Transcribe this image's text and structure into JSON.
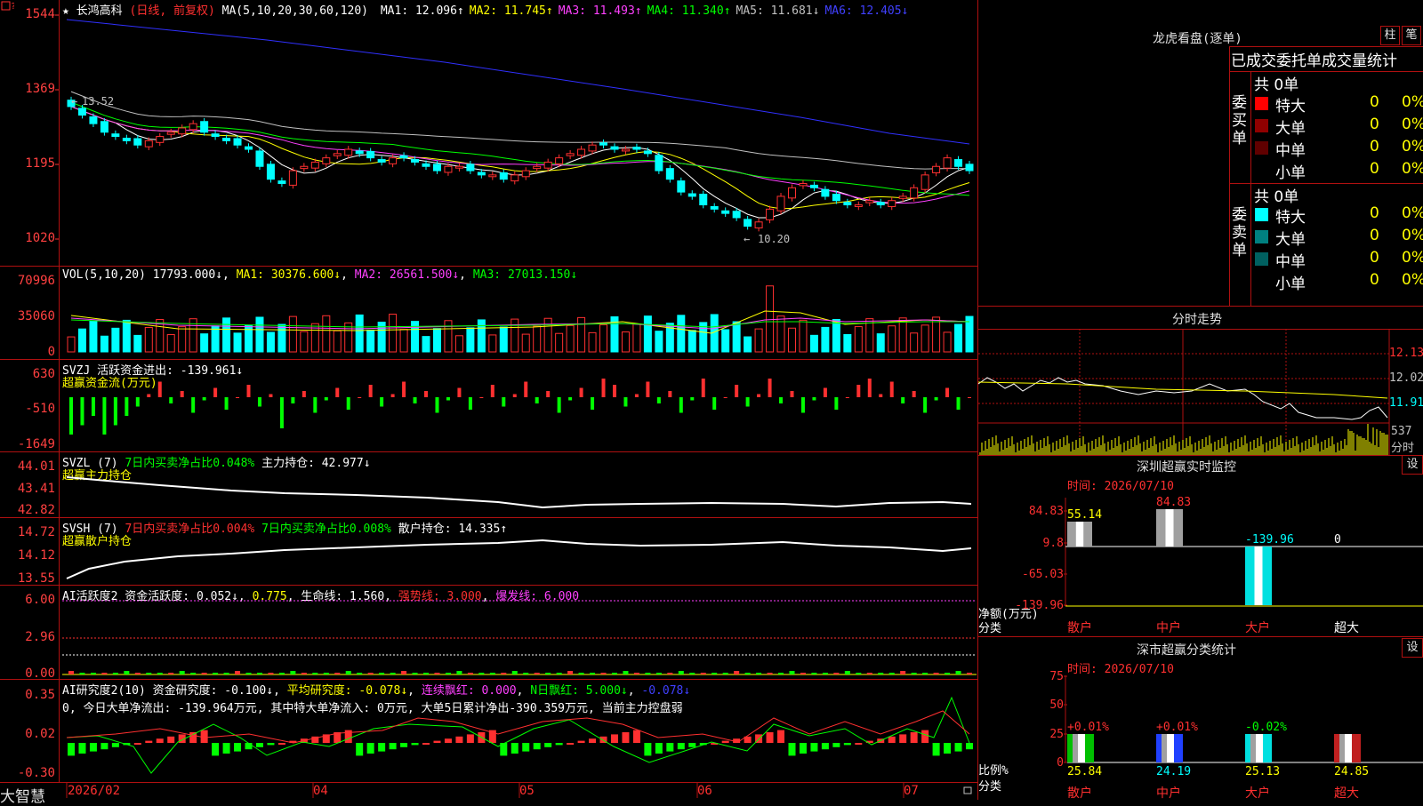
{
  "main": {
    "stock_name": "长鸿高科",
    "period_note": "(日线, 前复权)",
    "ma_header": "MA(5,10,20,30,60,120)",
    "ma_items": [
      {
        "label": "MA1:",
        "value": "12.096↑",
        "color": "#ffffff"
      },
      {
        "label": "MA2:",
        "value": "11.745↑",
        "color": "#ffff00"
      },
      {
        "label": "MA3:",
        "value": "11.493↑",
        "color": "#ff40ff"
      },
      {
        "label": "MA4:",
        "value": "11.340↑",
        "color": "#00ff00"
      },
      {
        "label": "MA5:",
        "value": "11.681↓",
        "color": "#c0c0c0"
      },
      {
        "label": "MA6:",
        "value": "12.405↓",
        "color": "#4040ff"
      }
    ],
    "y_ticks": [
      "1544",
      "1369",
      "1195",
      "1020"
    ],
    "high_note": "13.52",
    "low_note": "10.20"
  },
  "vol": {
    "header": "VOL(5,10,20)",
    "value": "17793.000↓",
    "ma1": "MA1: 30376.600↓",
    "ma2": "MA2: 26561.500↓",
    "ma3": "MA3: 27013.150↓",
    "y_ticks": [
      "70996",
      "35060",
      "0"
    ]
  },
  "svzj": {
    "header": "SVZJ  活跃资金进出: -139.961↓",
    "subtitle": "超赢资金流(万元)",
    "y_ticks": [
      "630",
      "-510",
      "-1649"
    ]
  },
  "svzl": {
    "header_a": "SVZL (7)",
    "header_b": "7日内买卖净占比0.048%",
    "header_c": "主力持仓: 42.977↓",
    "subtitle": "超赢主力持仓",
    "y_ticks": [
      "44.01",
      "43.41",
      "42.82"
    ]
  },
  "svsh": {
    "header_a": "SVSH (7)",
    "header_b": "7日内买卖净占比0.004%",
    "header_c": "7日内买卖净占比0.008%",
    "header_d": "散户持仓: 14.335↑",
    "subtitle": "超赢散户持仓",
    "y_ticks": [
      "14.72",
      "14.12",
      "13.55"
    ]
  },
  "ai1": {
    "header_a": "AI活跃度2 资金活跃度: 0.052↓",
    "header_b": "0.775",
    "header_c": "生命线: 1.560",
    "header_d": "强势线: 3.000",
    "header_e": "爆发线: 6.000",
    "y_ticks": [
      "6.00",
      "2.96",
      "0.00"
    ]
  },
  "ai2": {
    "header_a": "AI研究度2(10) 资金研究度: -0.100↓",
    "header_b": "平均研究度: -0.078↓",
    "header_c": "连续飘红: 0.000",
    "header_d": "N日飘红: 5.000↓",
    "header_e": "-0.078↓",
    "summary": "0, 今日大单净流出: -139.964万元, 其中特大单净流入: 0万元, 大单5日累计净出-390.359万元, 当前主力控盘弱",
    "y_ticks": [
      "0.35",
      "0.02",
      "-0.30"
    ]
  },
  "x_axis": {
    "labels": [
      "2026/02",
      "04",
      "05",
      "06",
      "07"
    ]
  },
  "brand": "大智慧",
  "right": {
    "lhb_title": "龙虎看盘(逐单)",
    "btn_bar": "柱",
    "btn_pen": "笔",
    "stats_title": "已成交委托单成交量统计",
    "buy_label": "委买单",
    "sell_label": "委卖单",
    "buy_total": "共 0单",
    "sell_total": "共 0单",
    "buy_rows": [
      {
        "name": "特大",
        "count": "0",
        "pct": "0%",
        "color": "#ff0000"
      },
      {
        "name": "大单",
        "count": "0",
        "pct": "0%",
        "color": "#900000"
      },
      {
        "name": "中单",
        "count": "0",
        "pct": "0%",
        "color": "#600000"
      },
      {
        "name": "小单",
        "count": "0",
        "pct": "0%",
        "color": "#000000"
      }
    ],
    "sell_rows": [
      {
        "name": "特大",
        "count": "0",
        "pct": "0%",
        "color": "#00ffff"
      },
      {
        "name": "大单",
        "count": "0",
        "pct": "0%",
        "color": "#008080"
      },
      {
        "name": "中单",
        "count": "0",
        "pct": "0%",
        "color": "#006060"
      },
      {
        "name": "小单",
        "count": "0",
        "pct": "0%",
        "color": "#000000"
      }
    ],
    "intraday_title": "分时走势",
    "intraday_ticks": [
      "12.13",
      "12.02",
      "11.91"
    ],
    "intraday_vol": "537",
    "intraday_vol_label": "分时",
    "sz_monitor_title": "深圳超赢实时监控",
    "sz_btn": "设",
    "monitor_time": "时间: 2026/07/10",
    "monitor_ticks": [
      "84.83",
      "9.8",
      "-65.03",
      "-139.96"
    ],
    "monitor_values": [
      "55.14",
      "84.83",
      "-139.96",
      "0"
    ],
    "monitor_unit": "净额(万元)",
    "monitor_cat": "分类",
    "monitor_cats": [
      "散户",
      "中户",
      "大户",
      "超大"
    ],
    "sz_class_title": "深市超赢分类统计",
    "class_btn": "设",
    "class_time": "时间: 2026/07/10",
    "class_ticks": [
      "75",
      "50",
      "25",
      "0"
    ],
    "class_pct_top": [
      "+0.01%",
      "+0.01%",
      "-0.02%"
    ],
    "class_pct_bottom": [
      "25.84",
      "24.19",
      "25.13",
      "24.85"
    ],
    "class_unit": "比例%",
    "class_cat": "分类",
    "class_cats": [
      "散户",
      "中户",
      "大户",
      "超大"
    ]
  },
  "chart_data": {
    "type": "candlestick",
    "note": "daily candles, values approximate read from price axis",
    "y_range": [
      10.2,
      15.44
    ],
    "closes": [
      13.3,
      13.1,
      12.9,
      12.7,
      12.6,
      12.5,
      12.4,
      12.5,
      12.6,
      12.7,
      12.8,
      12.9,
      12.7,
      12.6,
      12.5,
      12.4,
      12.3,
      11.9,
      11.6,
      11.5,
      11.8,
      11.9,
      12.0,
      12.1,
      12.2,
      12.3,
      12.2,
      12.1,
      12.0,
      12.1,
      12.1,
      12.0,
      11.9,
      11.8,
      11.9,
      11.9,
      11.8,
      11.7,
      11.7,
      11.6,
      11.7,
      11.8,
      11.9,
      12.0,
      12.1,
      12.2,
      12.3,
      12.4,
      12.4,
      12.3,
      12.3,
      12.3,
      12.2,
      11.8,
      11.6,
      11.3,
      11.2,
      11.0,
      10.9,
      10.8,
      10.7,
      10.5,
      10.6,
      10.9,
      11.2,
      11.4,
      11.5,
      11.4,
      11.2,
      11.1,
      11.0,
      11.0,
      11.1,
      11.0,
      11.1,
      11.2,
      11.4,
      11.7,
      11.9,
      12.1,
      11.9,
      11.8
    ],
    "ma_series_names": [
      "MA1",
      "MA2",
      "MA3",
      "MA4",
      "MA5",
      "MA6"
    ]
  }
}
